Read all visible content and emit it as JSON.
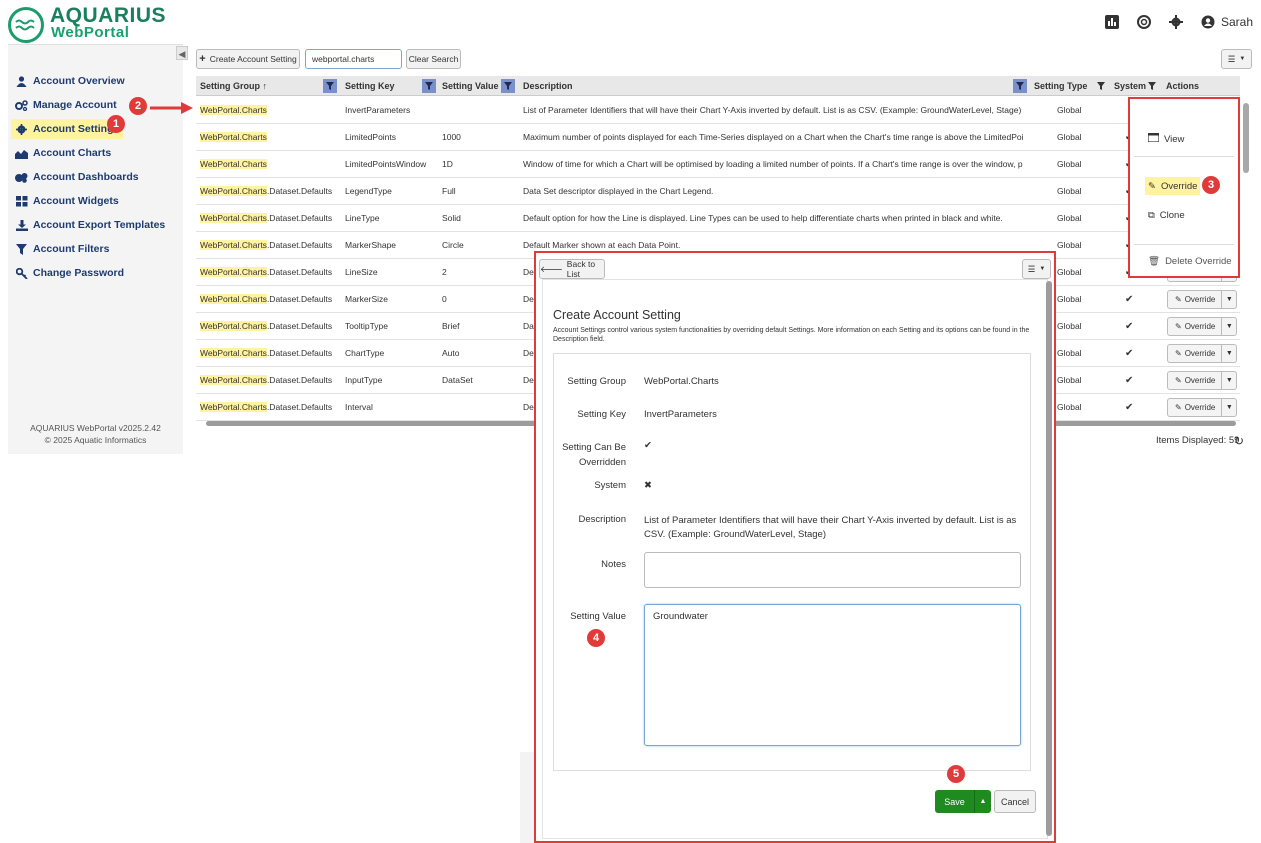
{
  "app": {
    "brand": "AQUARIUS",
    "sub": "WebPortal",
    "user": "Sarah"
  },
  "sidebar": {
    "items": [
      {
        "label": "Account Overview",
        "icon": "user-icon"
      },
      {
        "label": "Manage Account",
        "icon": "cogs-icon"
      },
      {
        "label": "Account Settings",
        "icon": "gear-icon"
      },
      {
        "label": "Account Charts",
        "icon": "area-chart-icon"
      },
      {
        "label": "Account Dashboards",
        "icon": "dashboard-icon"
      },
      {
        "label": "Account Widgets",
        "icon": "widgets-icon"
      },
      {
        "label": "Account Export Templates",
        "icon": "download-icon"
      },
      {
        "label": "Account Filters",
        "icon": "filter-icon"
      },
      {
        "label": "Change Password",
        "icon": "key-icon"
      }
    ],
    "footer_version": "AQUARIUS WebPortal v2025.2.42",
    "footer_copyright": "© 2025 Aquatic Informatics"
  },
  "toolbar": {
    "create_label": "Create Account Setting",
    "search_value": "webportal.charts",
    "clear_label": "Clear Search"
  },
  "table": {
    "columns": [
      "Setting Group ↑",
      "Setting Key",
      "Setting Value",
      "Description",
      "Setting Type",
      "System",
      "Actions"
    ],
    "rows": [
      {
        "group_hl": "WebPortal.Charts",
        "group_rest": "",
        "key": "InvertParameters",
        "value": "",
        "desc": "List of Parameter Identifiers that will have their Chart Y-Axis inverted by default. List is as CSV. (Example: GroundWaterLevel, Stage)",
        "type": "Global",
        "system": ""
      },
      {
        "group_hl": "WebPortal.Charts",
        "group_rest": "",
        "key": "LimitedPoints",
        "value": "1000",
        "desc": "Maximum number of points displayed for each Time-Series displayed on a Chart when the Chart's time range is above the LimitedPointsWi...",
        "type": "Global",
        "system": "✔"
      },
      {
        "group_hl": "WebPortal.Charts",
        "group_rest": "",
        "key": "LimitedPointsWindow",
        "value": "1D",
        "desc": "Window of time for which a Chart will be optimised by loading a limited number of points. If a Chart's time range is over the window, point...",
        "type": "Global",
        "system": "✔"
      },
      {
        "group_hl": "WebPortal.Charts",
        "group_rest": ".Dataset.Defaults",
        "key": "LegendType",
        "value": "Full",
        "desc": "Data Set descriptor displayed in the Chart Legend.",
        "type": "Global",
        "system": "✔"
      },
      {
        "group_hl": "WebPortal.Charts",
        "group_rest": ".Dataset.Defaults",
        "key": "LineType",
        "value": "Solid",
        "desc": "Default option for how the Line is displayed. Line Types can be used to help differentiate charts when printed in black and white.",
        "type": "Global",
        "system": "✔"
      },
      {
        "group_hl": "WebPortal.Charts",
        "group_rest": ".Dataset.Defaults",
        "key": "MarkerShape",
        "value": "Circle",
        "desc": "Default Marker shown at each Data Point.",
        "type": "Global",
        "system": "✔"
      },
      {
        "group_hl": "WebPortal.Charts",
        "group_rest": ".Dataset.Defaults",
        "key": "LineSize",
        "value": "2",
        "desc": "De",
        "type": "Global",
        "system": "✔"
      },
      {
        "group_hl": "WebPortal.Charts",
        "group_rest": ".Dataset.Defaults",
        "key": "MarkerSize",
        "value": "0",
        "desc": "De",
        "type": "Global",
        "system": "✔"
      },
      {
        "group_hl": "WebPortal.Charts",
        "group_rest": ".Dataset.Defaults",
        "key": "TooltipType",
        "value": "Brief",
        "desc": "Da",
        "type": "Global",
        "system": "✔"
      },
      {
        "group_hl": "WebPortal.Charts",
        "group_rest": ".Dataset.Defaults",
        "key": "ChartType",
        "value": "Auto",
        "desc": "De",
        "type": "Global",
        "system": "✔"
      },
      {
        "group_hl": "WebPortal.Charts",
        "group_rest": ".Dataset.Defaults",
        "key": "InputType",
        "value": "DataSet",
        "desc": "De",
        "type": "Global",
        "system": "✔"
      },
      {
        "group_hl": "WebPortal.Charts",
        "group_rest": ".Dataset.Defaults",
        "key": "Interval",
        "value": "",
        "desc": "De",
        "type": "Global",
        "system": "✔"
      }
    ],
    "override_label": "Override",
    "items_displayed": "Items Displayed: 59"
  },
  "menu": {
    "view": "View",
    "override": "Override",
    "clone": "Clone",
    "delete": "Delete Override"
  },
  "panel": {
    "back_label": "Back to List",
    "title": "Create Account Setting",
    "intro": "Account Settings control various system functionalities by overriding default Settings. More information on each Setting and its options can be found in the Description field.",
    "fields": {
      "group_label": "Setting Group",
      "group_value": "WebPortal.Charts",
      "key_label": "Setting Key",
      "key_value": "InvertParameters",
      "override_label": "Setting Can Be Overridden",
      "override_value": "✔",
      "system_label": "System",
      "system_value": "✖",
      "desc_label": "Description",
      "desc_value": "List of Parameter Identifiers that will have their Chart Y-Axis inverted by default. List is as CSV. (Example: GroundWaterLevel, Stage)",
      "notes_label": "Notes",
      "notes_value": "",
      "value_label": "Setting Value",
      "value_value": "Groundwater"
    },
    "save_label": "Save",
    "cancel_label": "Cancel"
  },
  "annotations": {
    "b1": "1",
    "b2": "2",
    "b3": "3",
    "b4": "4",
    "b5": "5"
  },
  "colors": {
    "accent": "#1a7f5c",
    "highlight": "#fff3a1",
    "annotation": "#e03b3b",
    "save": "#1f8a1f",
    "nav": "#1d3b70"
  }
}
